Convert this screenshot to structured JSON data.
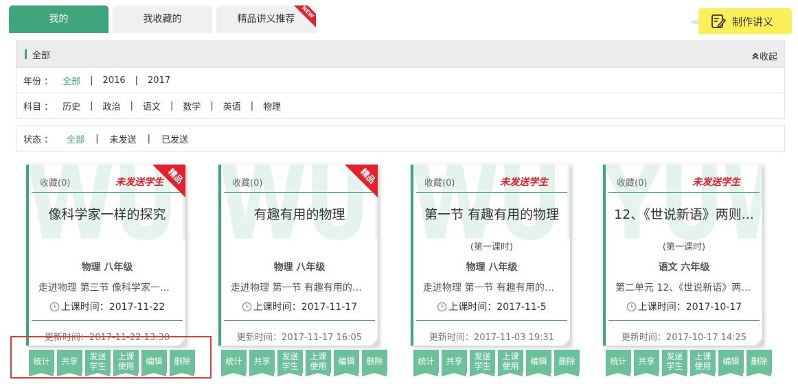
{
  "tabs": [
    {
      "label": "我的"
    },
    {
      "label": "我收藏的"
    },
    {
      "label": "精品讲义推荐",
      "badge": "NEW"
    }
  ],
  "make_button": {
    "label": "制作讲义"
  },
  "filter": {
    "current": "全部",
    "collapse_label": "收起",
    "year": {
      "label": "年份 ：",
      "options": [
        "全部",
        "2016",
        "2017"
      ],
      "selected": "全部"
    },
    "subject": {
      "label": "科目 ：",
      "options": [
        "历史",
        "政治",
        "语文",
        "数学",
        "英语",
        "物理"
      ]
    },
    "status": {
      "label": "状态 ：",
      "options": [
        "全部",
        "未发送",
        "已发送"
      ],
      "selected": "全部"
    }
  },
  "cards": [
    {
      "fav": "收藏(0)",
      "status": "未发送学生",
      "badge": "精品",
      "watermark": "WULI",
      "title": "像科学家一样的探究",
      "subtitle": "",
      "grade": "物理  八年级",
      "desc": "走进物理  第三节 像科学家一样...",
      "time": "上课时间：2017-11-22",
      "updated": "更新时间：2017-11-22 13:30"
    },
    {
      "fav": "收藏(0)",
      "status": "",
      "badge": "精品",
      "watermark": "WULI",
      "title": "有趣有用的物理",
      "subtitle": "",
      "grade": "物理  八年级",
      "desc": "走进物理  第一节 有趣有用的物...",
      "time": "上课时间：2017-11-17",
      "updated": "更新时间：2017-11-17 16:05"
    },
    {
      "fav": "收藏(0)",
      "status": "未发送学生",
      "badge": "",
      "watermark": "WULI",
      "title": "第一节 有趣有用的物理",
      "subtitle": "(第一课时)",
      "grade": "物理  八年级",
      "desc": "走进物理  第一节 有趣有用的物...",
      "time": "上课时间：2017-11-5",
      "updated": "更新时间：2017-11-03 19:31"
    },
    {
      "fav": "收藏(0)",
      "status": "未发送学生",
      "badge": "",
      "watermark": "YUWEN",
      "title": "12、《世说新语》两则...",
      "subtitle": "(第一课时)",
      "grade": "语文  六年级",
      "desc": "第二单元  12、《世说新语》两则...",
      "time": "上课时间：2017-10-17",
      "updated": "更新时间：2017-10-17 14:25"
    }
  ],
  "actions": [
    "统计",
    "共享",
    "发送\n学生",
    "上课\n使用",
    "编辑",
    "删除"
  ]
}
